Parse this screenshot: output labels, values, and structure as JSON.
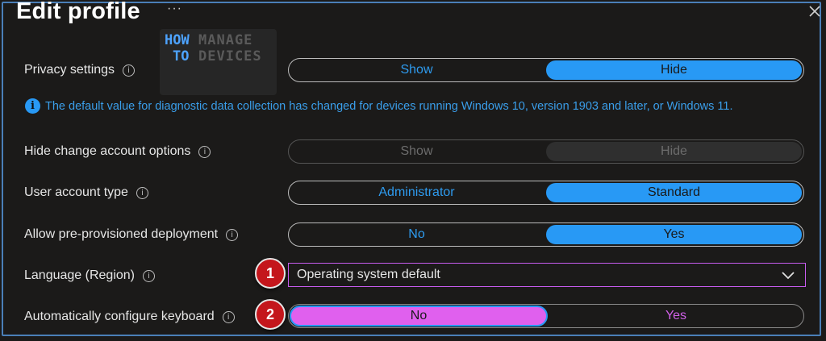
{
  "header": {
    "title": "Edit profile",
    "more": "···",
    "close_icon": "close-icon"
  },
  "watermark": {
    "line1a": "HOW",
    "line1b": "MANAGE",
    "line2a": "TO",
    "line2b": "DEVICES"
  },
  "banner": {
    "icon": "i",
    "text": "The default value for diagnostic data collection has changed for devices running Windows 10, version 1903 and later, or Windows 11."
  },
  "settings": {
    "privacy": {
      "label": "Privacy settings",
      "left": "Show",
      "right": "Hide",
      "selected": "Hide"
    },
    "hide_change_account": {
      "label": "Hide change account options",
      "left": "Show",
      "right": "Hide",
      "selected": "Hide",
      "disabled": true
    },
    "user_account_type": {
      "label": "User account type",
      "left": "Administrator",
      "right": "Standard",
      "selected": "Standard"
    },
    "pre_provisioned": {
      "label": "Allow pre-provisioned deployment",
      "left": "No",
      "right": "Yes",
      "selected": "Yes"
    },
    "language": {
      "label": "Language (Region)",
      "value": "Operating system default"
    },
    "keyboard": {
      "label": "Automatically configure keyboard",
      "left": "No",
      "right": "Yes",
      "selected": "No"
    }
  },
  "callouts": {
    "one": "1",
    "two": "2"
  },
  "colors": {
    "accent": "#2899f5",
    "highlight": "#e060ee",
    "callout": "#c4161c"
  }
}
